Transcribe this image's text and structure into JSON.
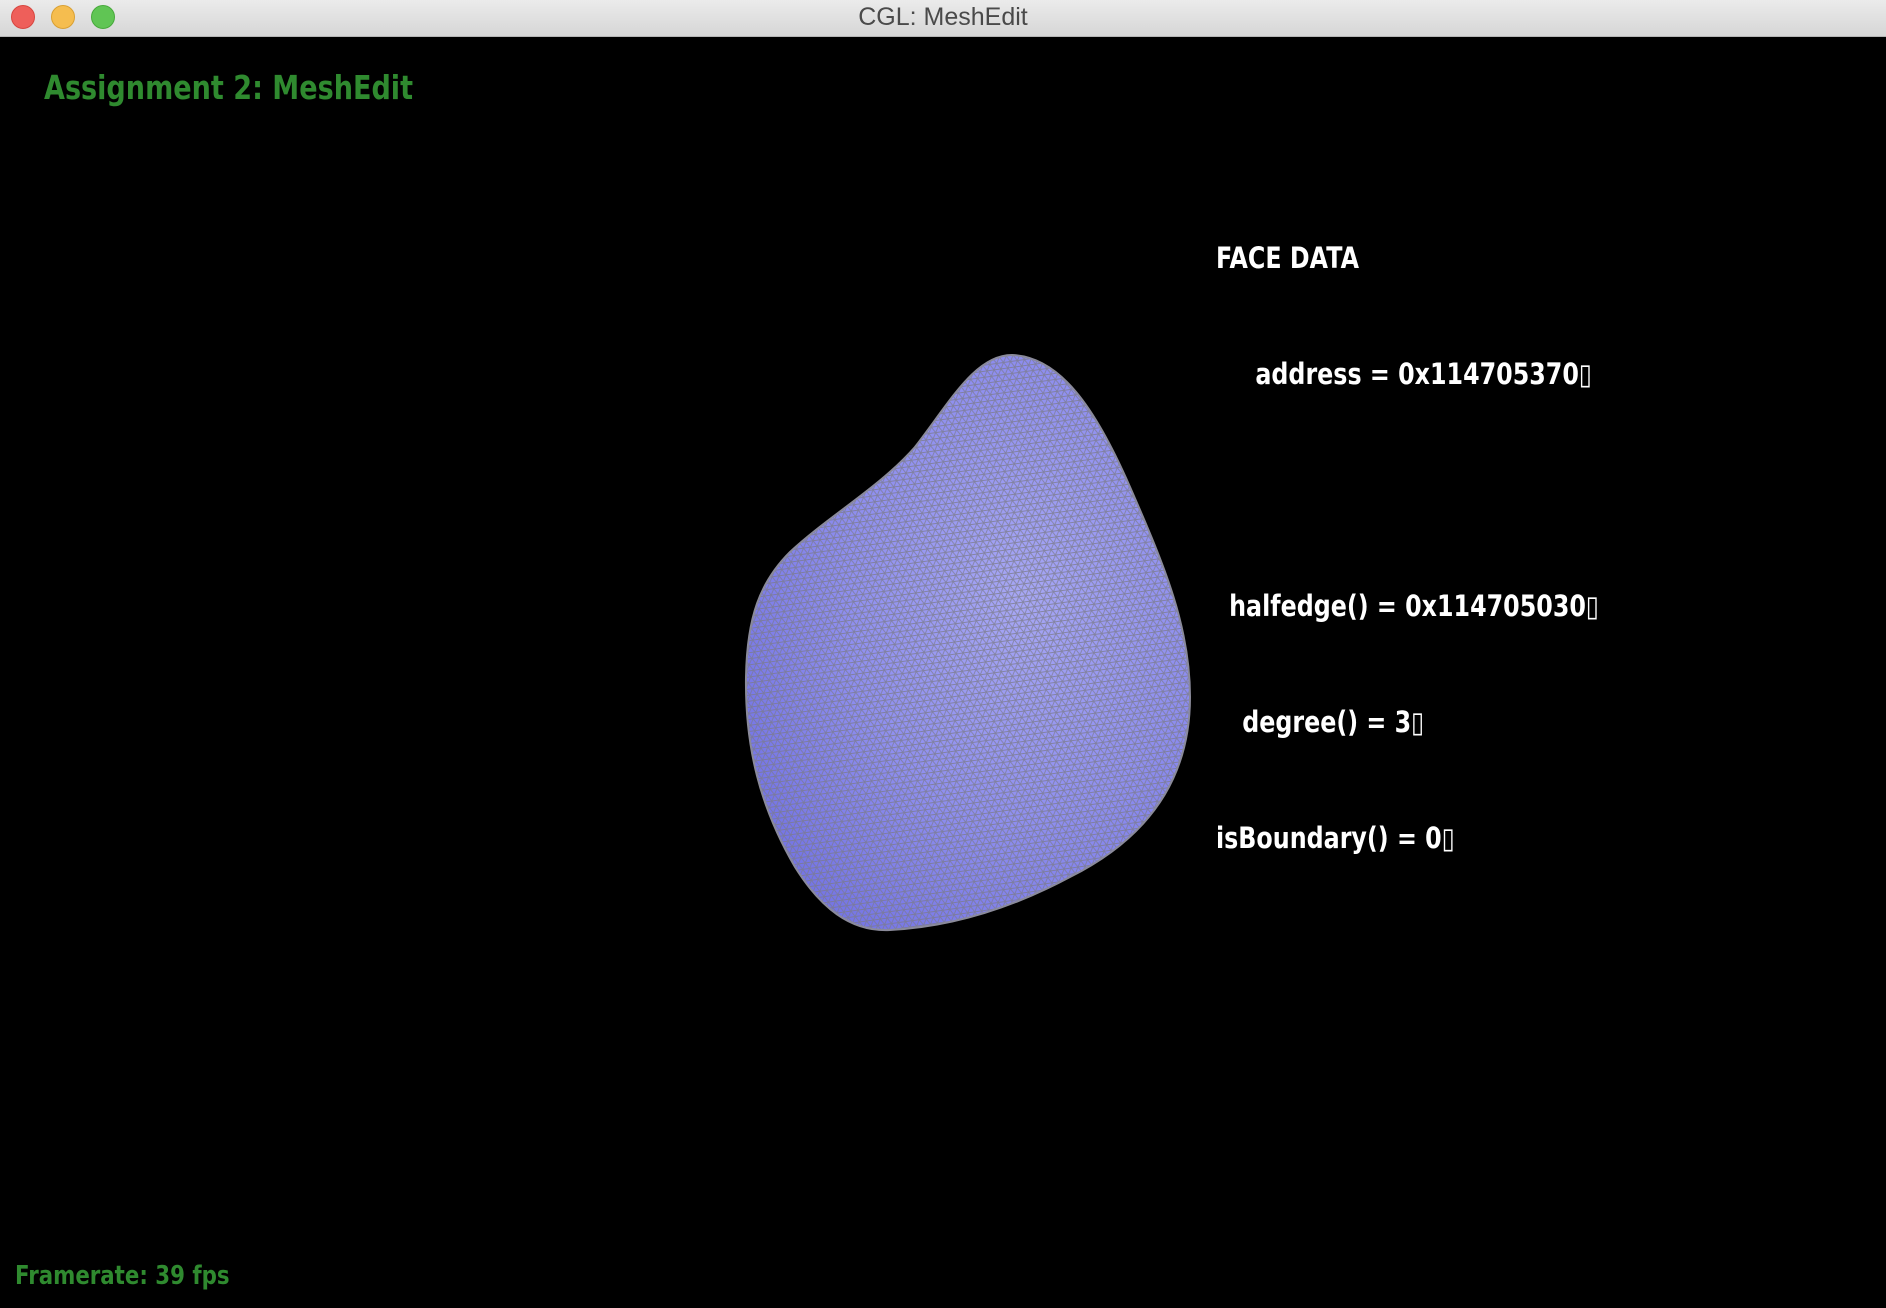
{
  "window": {
    "title": "CGL: MeshEdit"
  },
  "app": {
    "heading": "Assignment 2: MeshEdit"
  },
  "face_data": {
    "header": "FACE DATA",
    "address": "address = 0x114705370▯",
    "halfedge": "halfedge() = 0x114705030▯",
    "degree": "degree() = 3▯",
    "is_boundary": "isBoundary() = 0▯"
  },
  "status": {
    "framerate": "Framerate: 39 fps"
  },
  "colors": {
    "heading_green": "#2f8a2f",
    "mesh_fill": "#8d8df0",
    "mesh_wire": "#7a7a86",
    "background": "#000000"
  }
}
